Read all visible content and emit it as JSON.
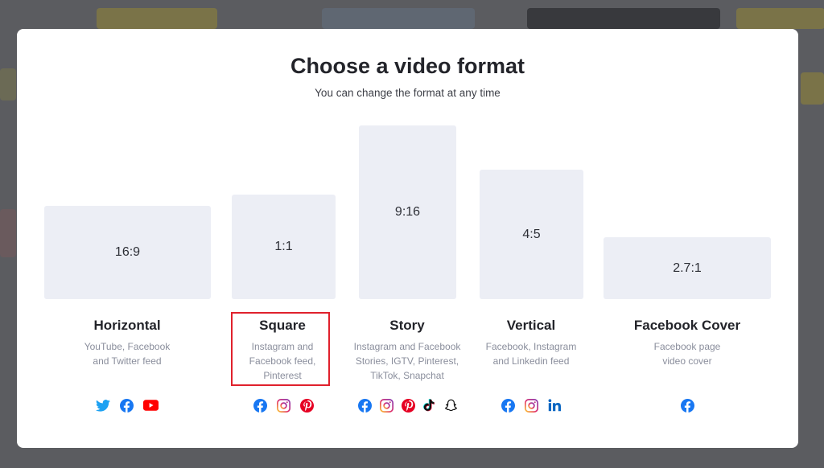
{
  "modal": {
    "title": "Choose a video format",
    "subtitle": "You can change the format at any time"
  },
  "formats": [
    {
      "ratio": "16:9",
      "name": "Horizontal",
      "desc": [
        "YouTube, Facebook",
        "and Twitter feed"
      ],
      "icons": [
        "twitter-icon",
        "facebook-icon",
        "youtube-icon"
      ]
    },
    {
      "ratio": "1:1",
      "name": "Square",
      "desc": [
        "Instagram and",
        "Facebook feed,",
        "Pinterest"
      ],
      "icons": [
        "facebook-icon",
        "instagram-icon",
        "pinterest-icon"
      ],
      "selected": true
    },
    {
      "ratio": "9:16",
      "name": "Story",
      "desc": [
        "Instagram and Facebook",
        "Stories, IGTV, Pinterest,",
        "TikTok, Snapchat"
      ],
      "icons": [
        "facebook-icon",
        "instagram-icon",
        "pinterest-icon",
        "tiktok-icon",
        "snapchat-icon"
      ]
    },
    {
      "ratio": "4:5",
      "name": "Vertical",
      "desc": [
        "Facebook, Instagram",
        "and Linkedin feed"
      ],
      "icons": [
        "facebook-icon",
        "instagram-icon",
        "linkedin-icon"
      ]
    },
    {
      "ratio": "2.7:1",
      "name": "Facebook Cover",
      "desc": [
        "Facebook page",
        "video cover"
      ],
      "icons": [
        "facebook-icon"
      ]
    }
  ],
  "colors": {
    "twitter": "#1da1f2",
    "facebook": "#1877f2",
    "youtube": "#ff0000",
    "pinterest": "#e60023",
    "linkedin": "#0a66c2",
    "selection": "#e0212c",
    "preview_bg": "#eceef5"
  }
}
